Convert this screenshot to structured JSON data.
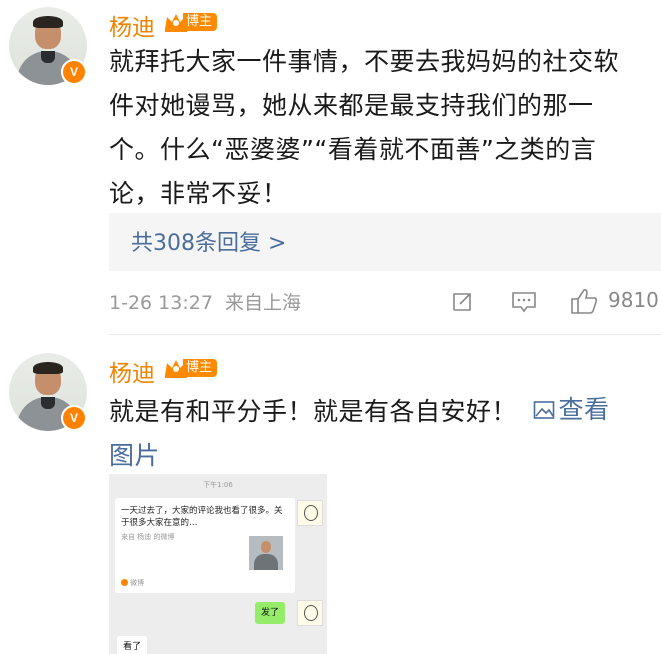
{
  "posts": [
    {
      "username": "杨迪",
      "badge_label": "博主",
      "verified_mark": "V",
      "text_lines": [
        "就拜托大家一件事情，不要去我妈妈的社交软",
        "件对她谩骂，她从来都是最支持我们的那一",
        "个。什么“恶婆婆”“看着就不面善”之类的言",
        "论，非常不妥！"
      ],
      "replies_label": "共308条回复 >",
      "timestamp": "1-26 13:27",
      "location": "来自上海",
      "like_count": "9810"
    },
    {
      "username": "杨迪",
      "badge_label": "博主",
      "verified_mark": "V",
      "text_line1": "就是有和平分手！就是有各自安好！",
      "view_image_label": "查看",
      "text_line2": "图片",
      "image": {
        "chat_time": "下午1:06",
        "card_text": "一天过去了，大家的评论我也看了很多。关于很多大家在意的…",
        "card_source": "来自 杨迪 的微博",
        "card_footer": "微博",
        "sent_message": "发了",
        "received_message": "看了"
      }
    }
  ],
  "icons": {
    "repost": "repost-icon",
    "comment": "comment-icon",
    "like": "thumbs-up-icon",
    "image": "image-icon",
    "crown": "crown-icon"
  },
  "colors": {
    "username": "#f08300",
    "link": "#4a6e9b",
    "meta": "#999999",
    "badge": "#ff8a00"
  }
}
